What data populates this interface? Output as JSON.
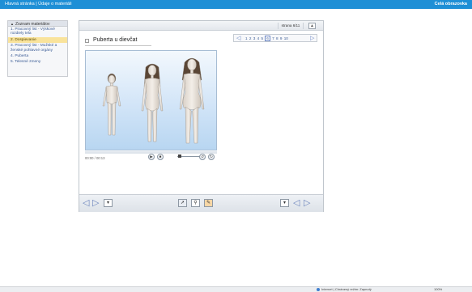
{
  "topbar": {
    "breadcrumb": "Hlavná stránka | Údaje o materiáli",
    "fullscreen_label": "Celá obrazovka",
    "color": "#1e8fd6"
  },
  "sidebar": {
    "header": "Zoznam materiálov",
    "items": [
      {
        "label": "1. Pracovný list - Výskové rozdiely tela"
      },
      {
        "label": "2. Dospievanie"
      },
      {
        "label": "3. Pracovný list - Mužské a ženské pohlavné orgány"
      },
      {
        "label": "4. Puberta"
      },
      {
        "label": "5. Telesné zmeny"
      }
    ],
    "active_index": 1
  },
  "viewer": {
    "page_indicator": "strana 6/11",
    "collapse_icon": "▲",
    "title": "Puberta u dievčat",
    "pager": {
      "prev_icon": "◁",
      "next_icon": "▷",
      "pages": [
        "1",
        "2",
        "3",
        "4",
        "5",
        "6",
        "7",
        "8",
        "9",
        "10"
      ],
      "current_page": "6"
    },
    "media": {
      "time": "00:00 / 00:13",
      "progress": 0.0,
      "volume": 0.1
    }
  },
  "statusbar": {
    "zone": "Internet | Chránený režim: Zapnutý",
    "zoom": "100%"
  }
}
